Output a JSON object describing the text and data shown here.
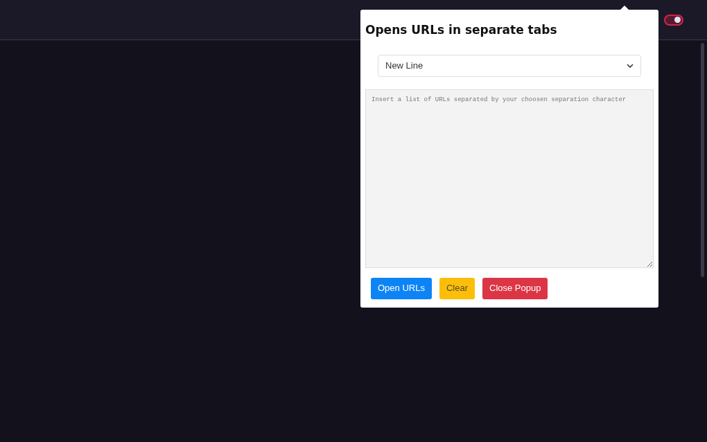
{
  "toggle": {
    "on": true
  },
  "popup": {
    "title": "Opens URLs in separate tabs",
    "select": {
      "value": "New Line"
    },
    "textarea": {
      "placeholder": "Insert a list of URLs separated by your choosen separation character"
    },
    "buttons": [
      {
        "label": "Open URLs",
        "kind": "primary"
      },
      {
        "label": "Clear",
        "kind": "warning"
      },
      {
        "label": "Close Popup",
        "kind": "danger"
      }
    ]
  }
}
